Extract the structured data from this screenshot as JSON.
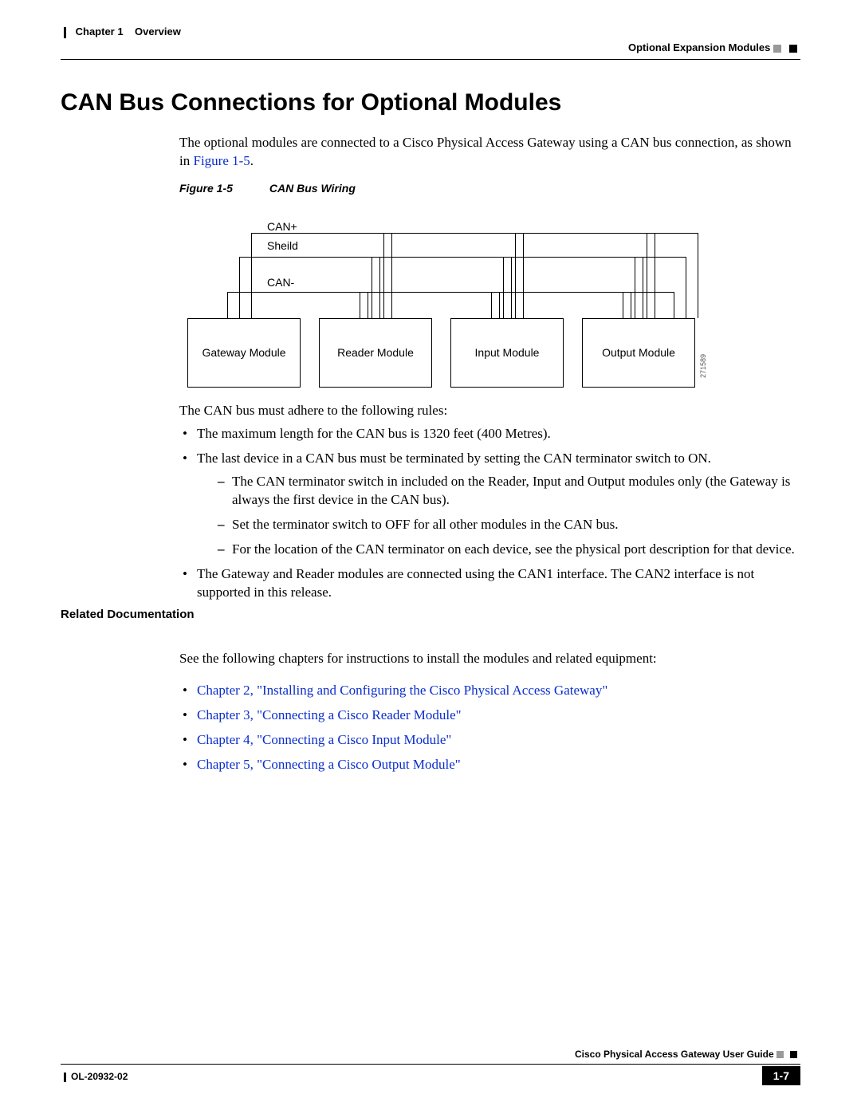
{
  "header": {
    "left_chapter": "Chapter 1",
    "left_title": "Overview",
    "right": "Optional Expansion Modules"
  },
  "title": "CAN Bus Connections for Optional Modules",
  "intro": {
    "text_a": "The optional modules are connected to a Cisco Physical Access Gateway using a CAN bus connection, as shown in ",
    "link": "Figure 1-5",
    "text_b": "."
  },
  "figure": {
    "num": "Figure 1-5",
    "caption": "CAN Bus Wiring",
    "labels": {
      "can_plus": "CAN+",
      "shield": "Sheild",
      "can_minus": "CAN-"
    },
    "modules": [
      "Gateway Module",
      "Reader Module",
      "Input Module",
      "Output Module"
    ],
    "diagram_id": "271589"
  },
  "rules_intro": "The CAN bus must adhere to the following rules:",
  "rules": [
    "The maximum length for the CAN bus is 1320 feet (400 Metres).",
    "The last device in a CAN bus must be terminated by setting the CAN terminator switch to ON.",
    "The Gateway and Reader modules are connected using the CAN1 interface. The CAN2 interface is not supported in this release."
  ],
  "rules_sub": [
    "The CAN terminator switch in included on the Reader, Input and Output modules only (the Gateway is always the first device in the CAN bus).",
    "Set the terminator switch to OFF for all other modules in the CAN bus.",
    "For the location of the CAN terminator on each device, see the physical port description for that device."
  ],
  "related": {
    "heading": "Related Documentation",
    "intro": "See the following chapters for instructions to install the modules and related equipment:",
    "links": [
      "Chapter 2, \"Installing and Configuring the Cisco Physical Access Gateway\"",
      "Chapter 3, \"Connecting a Cisco Reader Module\"",
      "Chapter 4, \"Connecting a Cisco Input Module\"",
      "Chapter 5, \"Connecting a Cisco Output Module\""
    ]
  },
  "footer": {
    "guide": "Cisco Physical Access Gateway User Guide",
    "docnum": "OL-20932-02",
    "page": "1-7"
  }
}
